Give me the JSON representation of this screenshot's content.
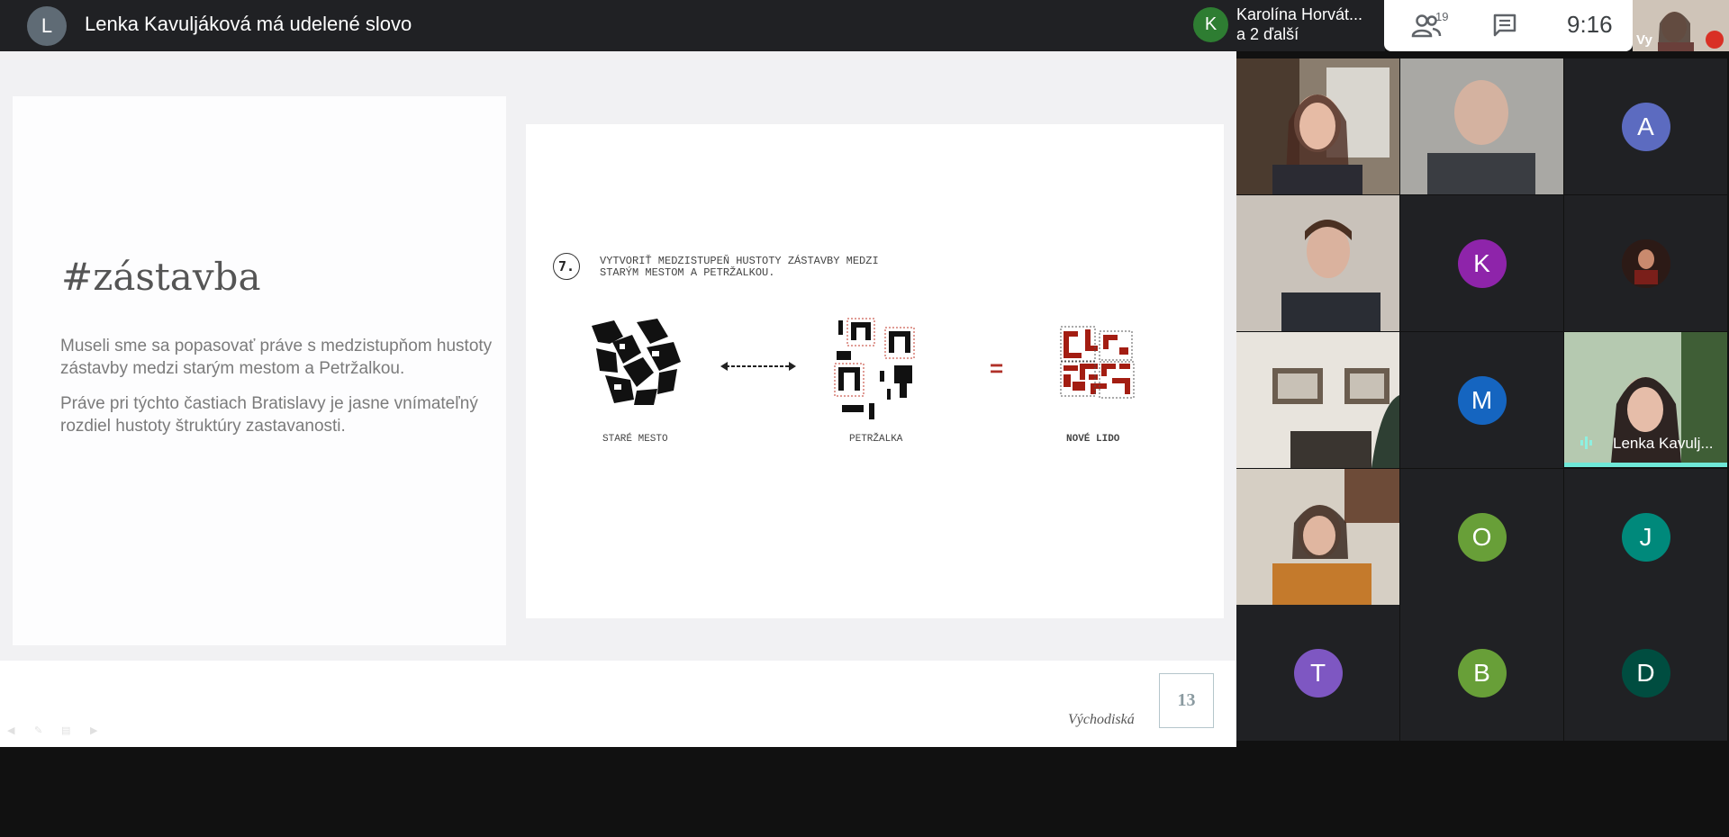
{
  "meeting": {
    "presenter_initial": "L",
    "presenter_title": "Lenka Kavuljáková má udelené slovo",
    "speaker_initial": "K",
    "speaker_name": "Karolína Horvát...",
    "speaker_sub": "a 2 ďalší",
    "participant_count": "19",
    "time": "9:16",
    "self_label": "Vy"
  },
  "slide": {
    "heading": "#zástavba",
    "paragraph1": "Museli sme sa popasovať práve s medzistupňom hustoty zástavby medzi starým mestom a Petržalkou.",
    "paragraph2": "Práve pri týchto častiach Bratislavy je jasne vnímateľný rozdiel hustoty štruktúry zastavanosti.",
    "step_number": "7.",
    "step_text": "VYTVORIŤ MEDZISTUPEŇ HUSTOTY ZÁSTAVBY MEDZI STARÝM MESTOM A PETRŽALKOU.",
    "captions": [
      "STARÉ MESTO",
      "PETRŽALKA",
      "NOVÉ LIDO"
    ],
    "equals": "=",
    "section": "Východiská",
    "page": "13"
  },
  "participants": [
    {
      "type": "camera",
      "name": ""
    },
    {
      "type": "camera",
      "name": ""
    },
    {
      "type": "avatar",
      "initial": "A",
      "color": "#5c6bc0"
    },
    {
      "type": "camera",
      "name": ""
    },
    {
      "type": "avatar",
      "initial": "K",
      "color": "#8e24aa"
    },
    {
      "type": "photo",
      "name": ""
    },
    {
      "type": "camera",
      "name": ""
    },
    {
      "type": "avatar",
      "initial": "M",
      "color": "#1565c0"
    },
    {
      "type": "camera",
      "name": "Lenka Kavulj..."
    },
    {
      "type": "camera",
      "name": ""
    },
    {
      "type": "avatar",
      "initial": "O",
      "color": "#689f38"
    },
    {
      "type": "avatar",
      "initial": "J",
      "color": "#00897b"
    },
    {
      "type": "avatar",
      "initial": "T",
      "color": "#7e57c2"
    },
    {
      "type": "avatar",
      "initial": "B",
      "color": "#689f38"
    },
    {
      "type": "avatar",
      "initial": "D",
      "color": "#004d40"
    }
  ]
}
